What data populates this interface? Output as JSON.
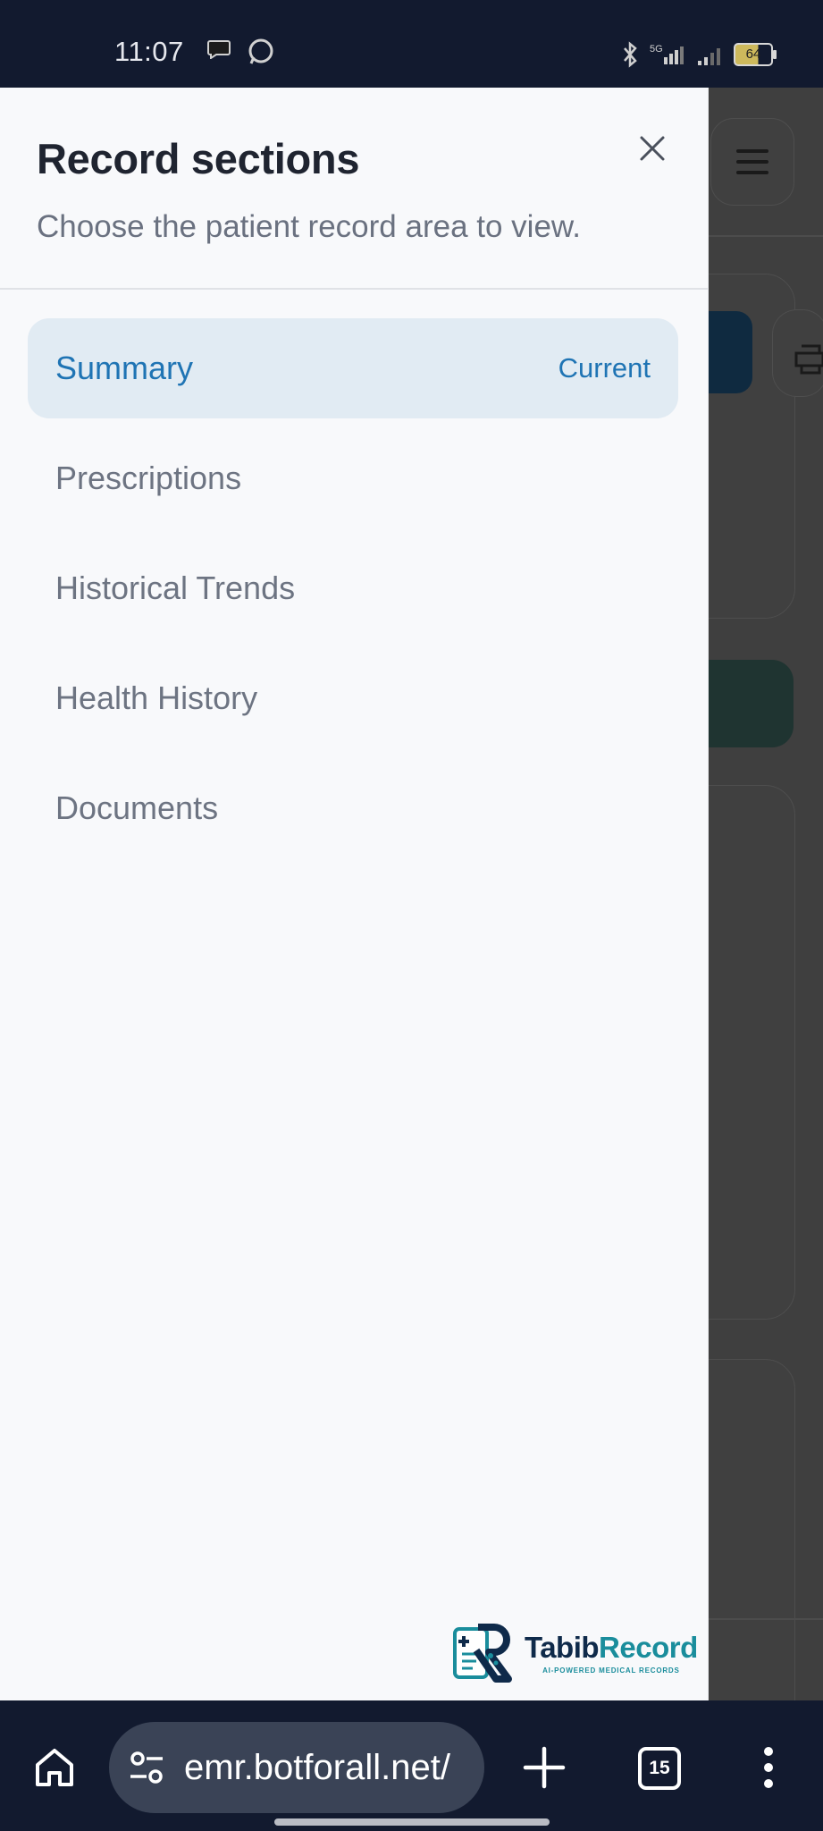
{
  "status_bar": {
    "time": "11:07",
    "battery_level": "64",
    "icons": [
      "message-icon",
      "whatsapp-icon",
      "bluetooth-icon",
      "5g-signal-icon",
      "signal-icon",
      "battery-icon"
    ]
  },
  "drawer": {
    "title": "Record sections",
    "subtitle": "Choose the patient record area to view.",
    "close_icon": "close-icon",
    "items": [
      {
        "label": "Summary",
        "badge": "Current",
        "active": true
      },
      {
        "label": "Prescriptions"
      },
      {
        "label": "Historical Trends"
      },
      {
        "label": "Health History"
      },
      {
        "label": "Documents"
      }
    ]
  },
  "brand": {
    "name_part1": "Tabib",
    "name_part2": "Record",
    "tagline": "AI-POWERED MEDICAL RECORDS"
  },
  "browser": {
    "url": "emr.botforall.net/",
    "tab_count": "15",
    "icons": [
      "home-icon",
      "site-settings-icon",
      "plus-icon",
      "tabs-icon",
      "more-icon"
    ]
  },
  "colors": {
    "accent": "#1f74b4",
    "active_bg": "#e1ebf3",
    "system_bar": "#121a2f",
    "brand_teal": "#1a8d9c",
    "brand_navy": "#0f2a4a"
  }
}
